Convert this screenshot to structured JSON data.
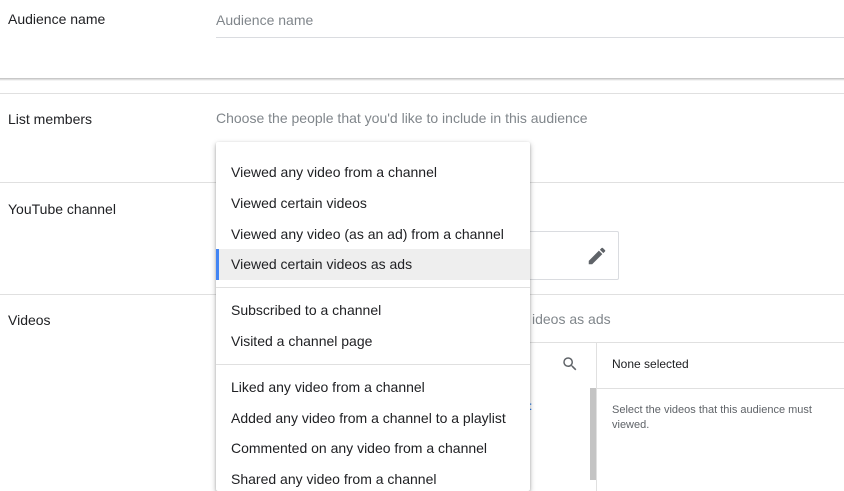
{
  "form": {
    "audience_name_label": "Audience name",
    "audience_name_placeholder": "Audience name",
    "list_members_label": "List members",
    "list_members_hint": "Choose the people that you'd like to include in this audience",
    "youtube_channel_label": "YouTube channel",
    "videos_label": "Videos",
    "videos_partial_text": "ideos as ads"
  },
  "video_picker": {
    "search_icon": "search-icon",
    "partial_mark": ":",
    "selected_title": "None selected",
    "helper_text": "Select the videos that this audience must viewed."
  },
  "dropdown": {
    "items": [
      {
        "label": "Viewed any video from a channel"
      },
      {
        "label": "Viewed certain videos"
      },
      {
        "label": "Viewed any video (as an ad) from a channel"
      },
      {
        "label": "Viewed certain videos as ads",
        "selected": true
      },
      {
        "label": "Subscribed to a channel"
      },
      {
        "label": "Visited a channel page"
      },
      {
        "label": "Liked any video from a channel"
      },
      {
        "label": "Added any video from a channel to a playlist"
      },
      {
        "label": "Commented on any video from a channel"
      },
      {
        "label": "Shared any video from a channel"
      }
    ]
  },
  "colors": {
    "accent": "#4285f4",
    "selected_bg": "#eeeeee",
    "muted_text": "#80868b"
  },
  "icons": {
    "edit": "pencil-icon",
    "search": "search-icon"
  }
}
